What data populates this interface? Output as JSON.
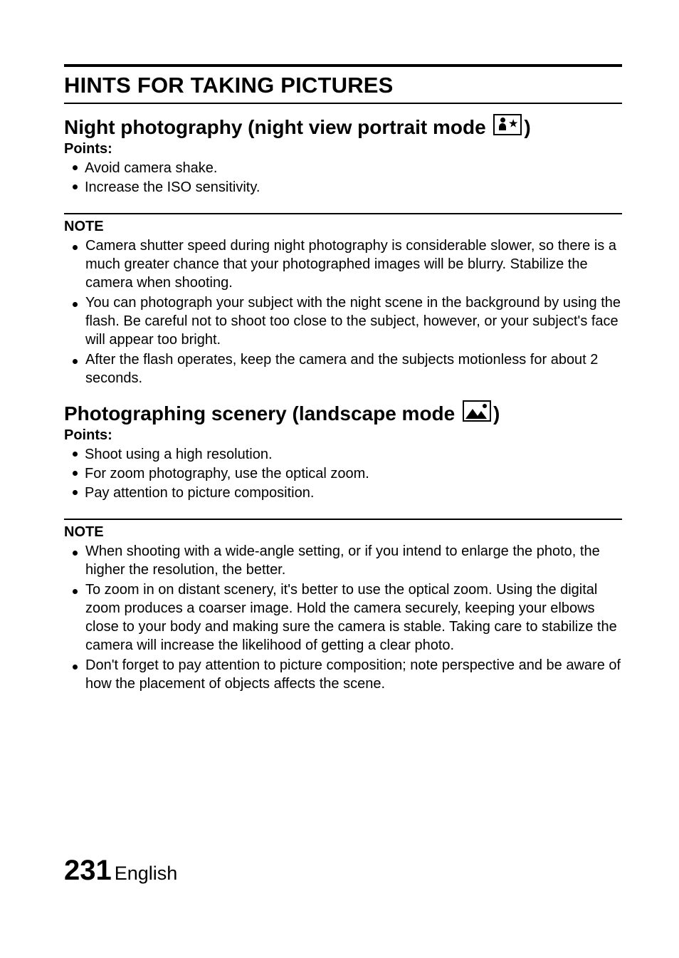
{
  "title": "HINTS FOR TAKING PICTURES",
  "sections": [
    {
      "heading_pre": "Night photography (night view portrait mode ",
      "heading_post": ")",
      "icon": "night-portrait-mode-icon",
      "points_label": "Points:",
      "points": [
        "Avoid camera shake.",
        "Increase the ISO sensitivity."
      ],
      "note_label": "NOTE",
      "notes": [
        "Camera shutter speed during night photography is considerable slower, so there is a much greater chance that your photographed images will be blurry. Stabilize the camera when shooting.",
        "You can photograph your subject with the night scene in the background by using the flash. Be careful not to shoot too close to the subject, however, or your subject's face will appear too bright.",
        "After the flash operates, keep the camera and the subjects motionless for about 2 seconds."
      ]
    },
    {
      "heading_pre": "Photographing scenery (landscape mode ",
      "heading_post": ")",
      "icon": "landscape-mode-icon",
      "points_label": "Points:",
      "points": [
        "Shoot using a high resolution.",
        "For zoom photography, use the optical zoom.",
        "Pay attention to picture composition."
      ],
      "note_label": "NOTE",
      "notes": [
        "When shooting with a wide-angle setting, or if you intend to enlarge the photo, the higher the resolution, the better.",
        "To zoom in on distant scenery, it's better to use the optical zoom. Using the digital zoom produces a coarser image. Hold the camera securely, keeping your elbows close to your body and making sure the camera is stable. Taking care to stabilize the camera will increase the likelihood of getting a clear photo.",
        "Don't forget to pay attention to picture composition; note perspective and be aware of how the placement of objects affects the scene."
      ]
    }
  ],
  "footer": {
    "page": "231",
    "lang": "English"
  }
}
